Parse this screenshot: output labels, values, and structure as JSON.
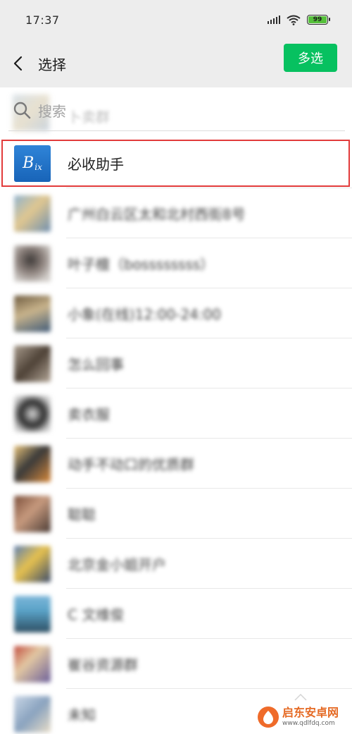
{
  "status_bar": {
    "time": "17:37",
    "battery": "99"
  },
  "nav": {
    "title": "选择",
    "multi_select_label": "多选"
  },
  "search": {
    "placeholder": "搜索",
    "background_hint": "卜卖群"
  },
  "contacts": [
    {
      "name": "必收助手",
      "blurred": false
    },
    {
      "name": "广州白云区太和北村西街8号",
      "blurred": true
    },
    {
      "name": "叶子檀（bossssssss）",
      "blurred": true
    },
    {
      "name": "小象(在线)12:00-24:00",
      "blurred": true
    },
    {
      "name": "怎么回事",
      "blurred": true
    },
    {
      "name": "卖衣服",
      "blurred": true
    },
    {
      "name": "动手不动口的优质群",
      "blurred": true
    },
    {
      "name": "聪聪",
      "blurred": true
    },
    {
      "name": "北京金小姐开户",
      "blurred": true
    },
    {
      "name": "C 文维俊",
      "blurred": true
    },
    {
      "name": "崔谷资源群",
      "blurred": true
    },
    {
      "name": "未知",
      "blurred": true
    }
  ],
  "watermark": {
    "title": "启东安卓网",
    "url": "www.qdlfdq.com"
  },
  "colors": {
    "accent": "#07c160",
    "highlight": "#e23b3b",
    "header_bg": "#ededed"
  }
}
